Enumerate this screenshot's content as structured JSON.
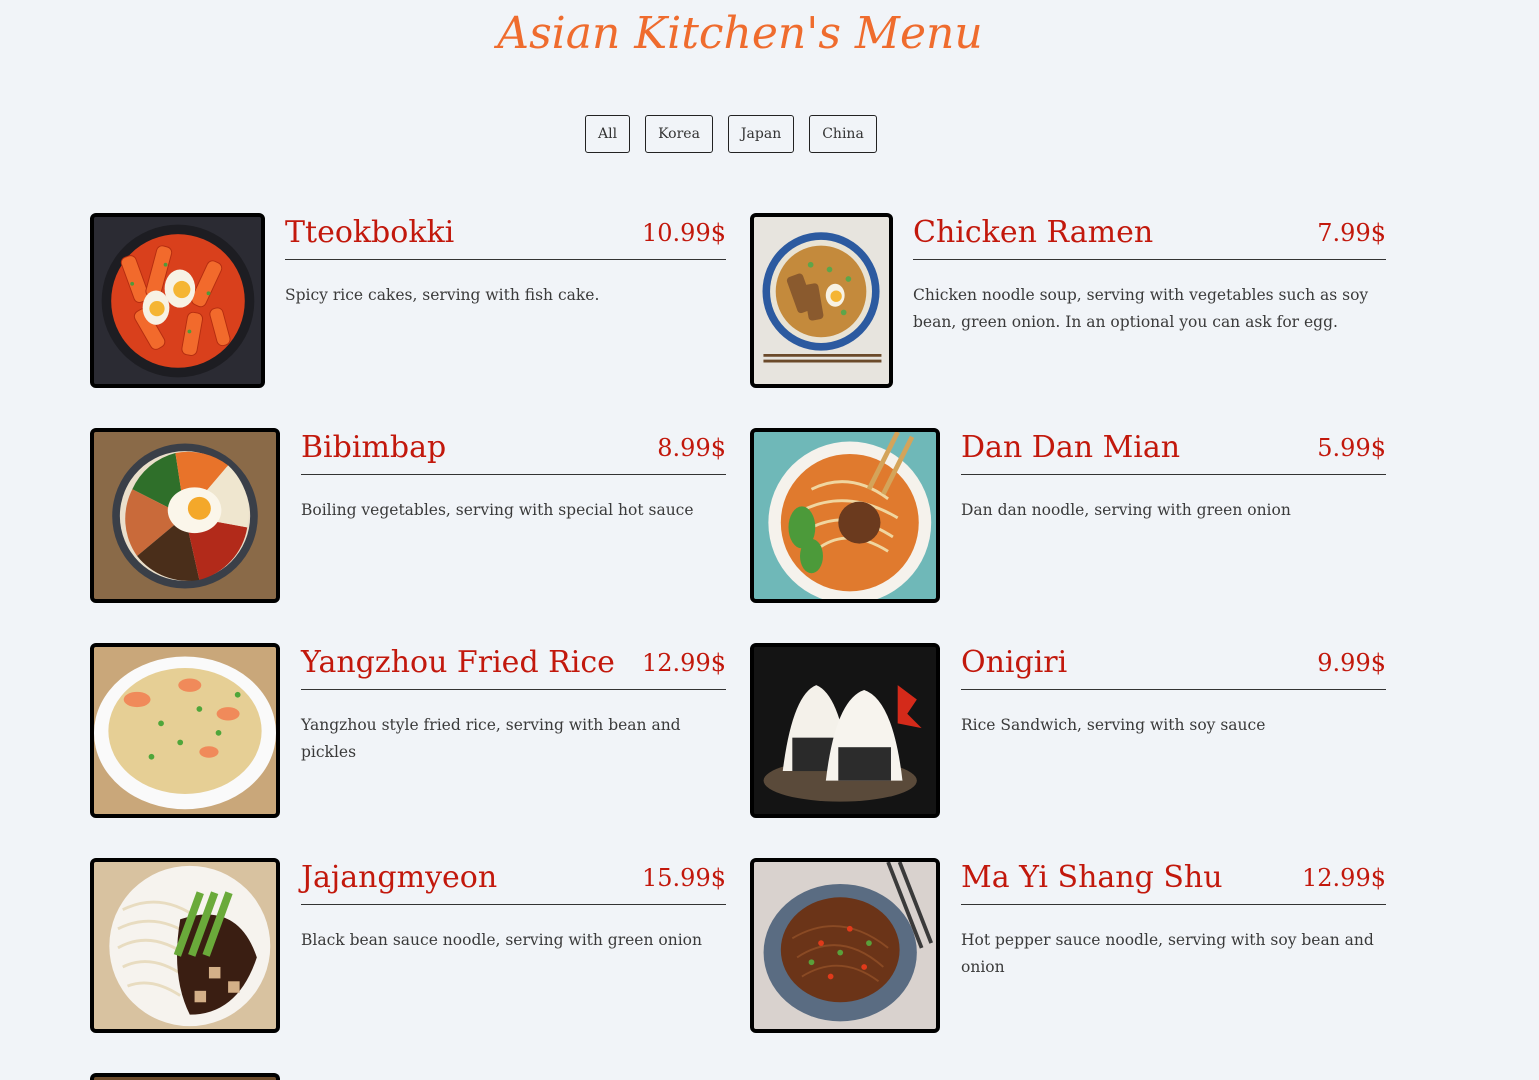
{
  "page": {
    "title": "Asian Kitchen's Menu"
  },
  "filters": [
    "All",
    "Korea",
    "Japan",
    "China"
  ],
  "items": [
    {
      "name": "Tteokbokki",
      "price": "10.99$",
      "description": "Spicy rice cakes, serving with fish cake.",
      "image": "tteokbokki-photo"
    },
    {
      "name": "Chicken Ramen",
      "price": "7.99$",
      "description": "Chicken noodle soup, serving with vegetables such as soy bean, green onion. In an optional you can ask for egg.",
      "image": "chicken-ramen-photo"
    },
    {
      "name": "Bibimbap",
      "price": "8.99$",
      "description": "Boiling vegetables, serving with special hot sauce",
      "image": "bibimbap-photo"
    },
    {
      "name": "Dan Dan Mian",
      "price": "5.99$",
      "description": "Dan dan noodle, serving with green onion",
      "image": "dan-dan-mian-photo"
    },
    {
      "name": "Yangzhou Fried Rice",
      "price": "12.99$",
      "description": "Yangzhou style fried rice, serving with bean and pickles",
      "image": "yangzhou-fried-rice-photo"
    },
    {
      "name": "Onigiri",
      "price": "9.99$",
      "description": "Rice Sandwich, serving with soy sauce",
      "image": "onigiri-photo"
    },
    {
      "name": "Jajangmyeon",
      "price": "15.99$",
      "description": "Black bean sauce noodle, serving with green onion",
      "image": "jajangmyeon-photo"
    },
    {
      "name": "Ma Yi Shang Shu",
      "price": "12.99$",
      "description": "Hot pepper sauce noodle, serving with soy bean and onion",
      "image": "ma-yi-shang-shu-photo"
    }
  ],
  "colors": {
    "title": "#ef6c2e",
    "item_text": "#c2180c",
    "background": "#f1f4f8"
  }
}
